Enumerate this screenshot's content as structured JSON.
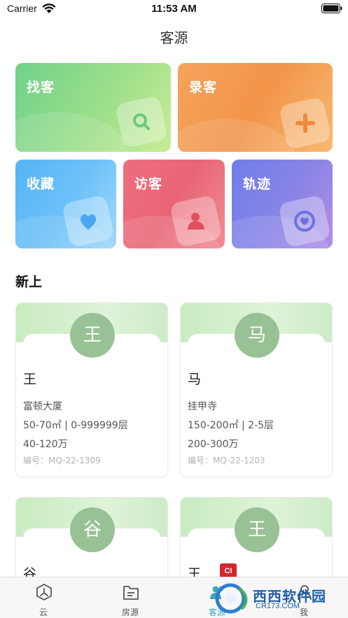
{
  "status_bar": {
    "carrier": "Carrier",
    "time": "11:53 AM"
  },
  "page_title": "客源",
  "tiles": [
    {
      "label": "找客",
      "icon": "search-icon"
    },
    {
      "label": "录客",
      "icon": "plus-icon"
    },
    {
      "label": "收藏",
      "icon": "heart-icon"
    },
    {
      "label": "访客",
      "icon": "person-icon"
    },
    {
      "label": "轨迹",
      "icon": "heart-circle-icon"
    }
  ],
  "section_title": "新上",
  "customers": [
    {
      "avatar": "王",
      "name": "王",
      "building": "富顿大厦",
      "area_floor": "50-70㎡ | 0-999999层",
      "price": "40-120万",
      "code": "编号：MQ-22-1309"
    },
    {
      "avatar": "马",
      "name": "马",
      "building": "挂甲寺",
      "area_floor": "150-200㎡ | 2-5层",
      "price": "200-300万",
      "code": "编号：MQ-22-1203"
    },
    {
      "avatar": "谷",
      "name": "谷"
    },
    {
      "avatar": "王",
      "name": "王",
      "badge": "CI"
    }
  ],
  "tab_bar": [
    {
      "label": "云",
      "icon": "cloud-hexagon-icon",
      "active": false
    },
    {
      "label": "房源",
      "icon": "document-icon",
      "active": false
    },
    {
      "label": "客源",
      "icon": "people-icon",
      "active": true
    },
    {
      "label": "我",
      "icon": "user-icon",
      "active": false
    }
  ],
  "watermark": {
    "text": "西西软件园",
    "sub": "CR173.COM"
  },
  "colors": {
    "accent": "#3aa9b8",
    "avatar": "#98c195"
  }
}
